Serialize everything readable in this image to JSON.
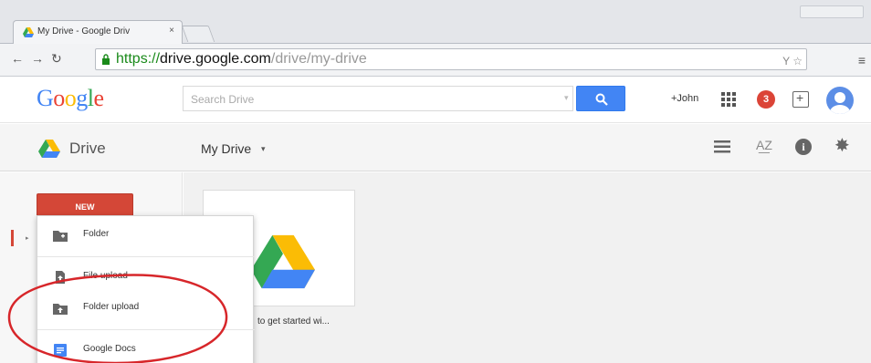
{
  "browser": {
    "tab_title": "My Drive - Google Driv",
    "tab_close": "×",
    "url_scheme": "https://",
    "url_host": "drive.google.com",
    "url_path": "/drive/my-drive",
    "nav_back": "←",
    "nav_forward": "→",
    "nav_reload": "↻",
    "omnibox_icons": "Y ☆",
    "menu_glyph": "≡"
  },
  "header": {
    "logo_letters": [
      "G",
      "o",
      "o",
      "g",
      "l",
      "e"
    ],
    "logo_colors": [
      "#4285f4",
      "#ea4335",
      "#fbbc05",
      "#4285f4",
      "#34a853",
      "#ea4335"
    ],
    "search_placeholder": "Search Drive",
    "user_link": "+John",
    "notification_count": "3",
    "icons": [
      "apps-grid-icon",
      "notification-badge",
      "share-icon",
      "avatar"
    ]
  },
  "subheader": {
    "app_name": "Drive",
    "location": "My Drive",
    "location_caret": "▾",
    "sort_glyph": "A͟Z",
    "info_glyph": "i",
    "gear_glyph": "✸"
  },
  "sidebar": {
    "new_button": "NEW",
    "arrow_glyph": "▸"
  },
  "new_menu": {
    "items": [
      {
        "label": "Folder",
        "icon": "folder-icon"
      },
      {
        "label": "File upload",
        "icon": "file-upload-icon"
      },
      {
        "label": "Folder upload",
        "icon": "folder-upload-icon"
      },
      {
        "label": "Google Docs",
        "icon": "google-docs-icon"
      }
    ]
  },
  "main": {
    "card_caption": "to get started wi..."
  },
  "colors": {
    "accent_red": "#d44737",
    "search_blue": "#4285f4",
    "annotation_red": "#d7262a"
  }
}
